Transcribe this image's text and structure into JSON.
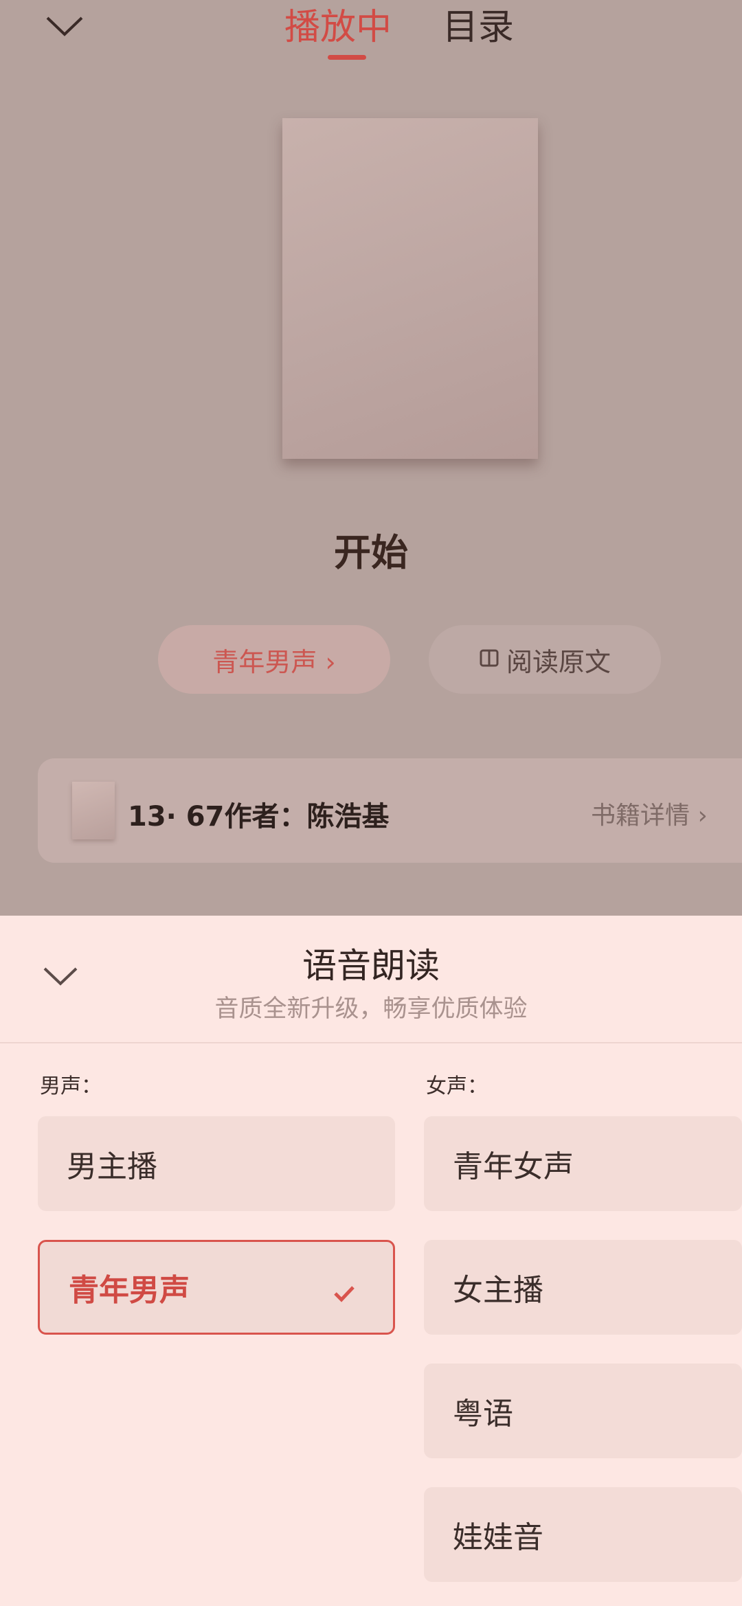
{
  "header": {
    "tabs": [
      {
        "label": "播放中",
        "active": true
      },
      {
        "label": "目录",
        "active": false
      }
    ]
  },
  "player": {
    "title": "开始",
    "voice_pill": "青年男声 ›",
    "read_original": "阅读原文"
  },
  "book": {
    "title": "13· 67作者：陈浩基",
    "detail_link": "书籍详情 ›"
  },
  "sheet": {
    "title": "语音朗读",
    "subtitle": "音质全新升级，畅享优质体验",
    "male_label": "男声：",
    "female_label": "女声：",
    "male_voices": [
      {
        "label": "男主播",
        "selected": false
      },
      {
        "label": "青年男声",
        "selected": true
      }
    ],
    "female_voices": [
      {
        "label": "青年女声"
      },
      {
        "label": "女主播"
      },
      {
        "label": "粤语"
      },
      {
        "label": "娃娃音"
      }
    ]
  },
  "colors": {
    "accent": "#d24b45",
    "overlay_bg": "#b5a29d",
    "sheet_bg": "#fde7e3"
  }
}
